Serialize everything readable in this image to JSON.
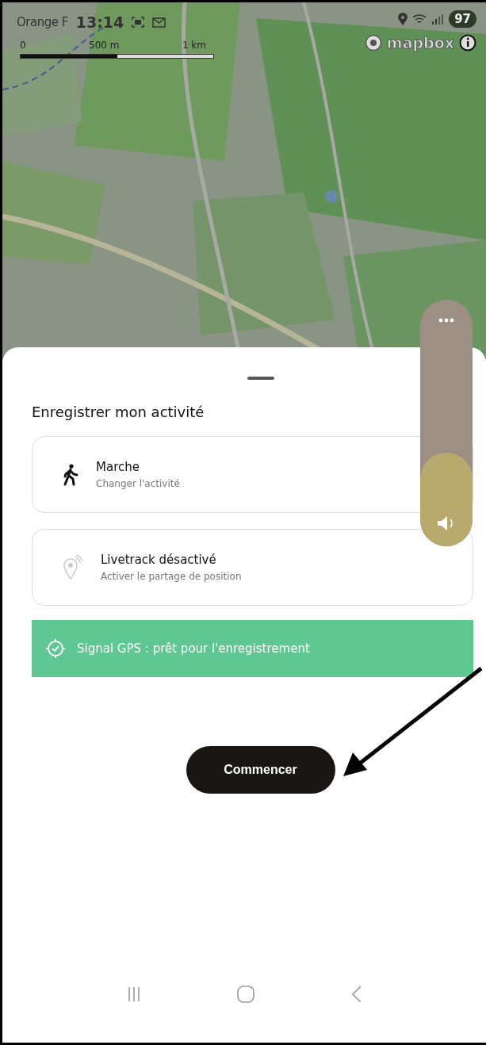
{
  "status_bar": {
    "carrier": "Orange F",
    "time": "13:14",
    "battery": "97"
  },
  "map": {
    "scale_labels": [
      "0",
      "500 m",
      "1 km"
    ],
    "attribution": "mapbox"
  },
  "sheet": {
    "title": "Enregistrer mon activité",
    "options": [
      {
        "kind": "walk",
        "title": "Marche",
        "subtitle": "Changer l'activité"
      },
      {
        "kind": "livetrack",
        "title": "Livetrack désactivé",
        "subtitle": "Activer le partage de position"
      }
    ],
    "gps_banner": "Signal GPS : prêt pour l'enregistrement",
    "start_button": "Commencer"
  },
  "volume": {
    "level": 0.38
  }
}
